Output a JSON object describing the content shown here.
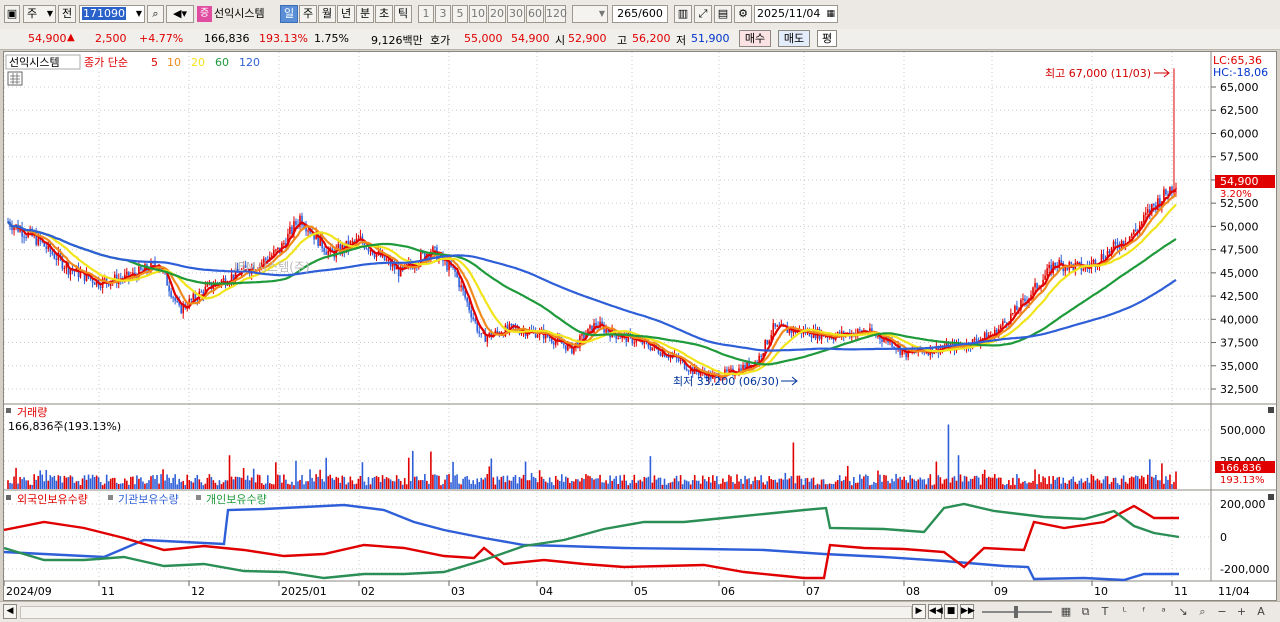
{
  "toolbar": {
    "period_unit": "주",
    "prev_label": "전",
    "stock_code": "171090",
    "badge": "증",
    "stock_name": "선익시스템",
    "period_tabs": [
      "일",
      "주",
      "월",
      "년",
      "분",
      "초",
      "틱"
    ],
    "active_tab": "일",
    "interval_buttons": [
      "1",
      "3",
      "5",
      "10",
      "20",
      "30",
      "60",
      "120"
    ],
    "count_label": "265",
    "count_total": "/600",
    "date": "2025/11/04"
  },
  "infobar": {
    "price": "54,900",
    "arrow": "▲",
    "change": "2,500",
    "change_pct": "+4.77%",
    "volume": "166,836",
    "volume_ratio": "193.13%",
    "turnover": "1.75%",
    "amount": "9,126백만",
    "quote_label": "호가",
    "bid": "55,000",
    "ask": "54,900",
    "open_label": "시",
    "open": "52,900",
    "high_label": "고",
    "high": "56,200",
    "low_label": "저",
    "low": "51,900",
    "buy_button": "매수",
    "sell_button": "매도",
    "eval_button": "평"
  },
  "price_panel": {
    "legend_name": "선익시스템",
    "legend_ma_label": "종가 단순",
    "ma_periods": [
      "5",
      "10",
      "20",
      "60",
      "120"
    ],
    "ma_colors": [
      "#e00000",
      "#f08a1c",
      "#f2e41a",
      "#1e9a3a",
      "#2f5fd8"
    ],
    "top_right_lc": "LC:65,36",
    "top_right_hc": "HC:-18,06",
    "high_marker": "최고 67,000 (11/03)",
    "low_marker": "최저 33,200 (06/30)",
    "current_price_tag": "54,900",
    "current_pct_tag": "3.20%",
    "faded_overlay": "IBM시스템(주)",
    "y_ticks": [
      "65,000",
      "62,500",
      "60,000",
      "57,500",
      "55,000",
      "52,500",
      "50,000",
      "47,500",
      "45,000",
      "42,500",
      "40,000",
      "37,500",
      "35,000",
      "32,500"
    ]
  },
  "volume_panel": {
    "title": "거래량",
    "current": "166,836주(193.13%)",
    "y_ticks": [
      "500,000",
      "250,000"
    ],
    "tag_value": "166,836",
    "tag_pct": "193.13%"
  },
  "holding_panel": {
    "legend": [
      "외국인보유수량",
      "기관보유수량",
      "개인보유수량"
    ],
    "y_ticks": [
      "200,000",
      "0",
      "-200,000"
    ]
  },
  "x_axis": {
    "labels": [
      "2024/09",
      "11",
      "12",
      "2025/01",
      "02",
      "03",
      "04",
      "05",
      "06",
      "07",
      "08",
      "09",
      "10",
      "11"
    ],
    "end_label": "11/04"
  },
  "chart_data": {
    "type": "candlestick",
    "title": "선익시스템",
    "period": "daily",
    "high": {
      "value": 67000,
      "date": "11/03"
    },
    "low": {
      "value": 33200,
      "date": "06/30"
    },
    "last": {
      "price": 54900,
      "open": 52900,
      "high": 56200,
      "low": 51900,
      "volume": 166836
    },
    "ylim": [
      31000,
      68500
    ],
    "moving_averages": [
      5,
      10,
      20,
      60,
      120
    ]
  }
}
